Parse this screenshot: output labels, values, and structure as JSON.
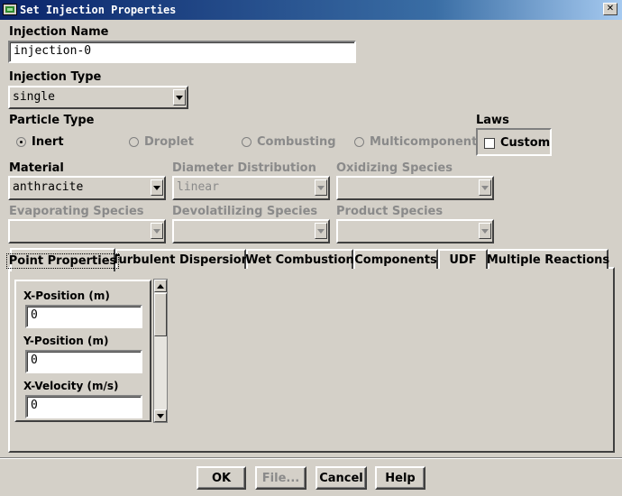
{
  "window": {
    "title": "Set Injection Properties",
    "close_glyph": "✕"
  },
  "injection_name": {
    "label": "Injection Name",
    "value": "injection-0"
  },
  "injection_type": {
    "label": "Injection Type",
    "value": "single"
  },
  "particle_type": {
    "label": "Particle Type",
    "options": [
      {
        "label": "Inert",
        "selected": true,
        "enabled": true
      },
      {
        "label": "Droplet",
        "selected": false,
        "enabled": false
      },
      {
        "label": "Combusting",
        "selected": false,
        "enabled": false
      },
      {
        "label": "Multicomponent",
        "selected": false,
        "enabled": false
      }
    ]
  },
  "laws": {
    "label": "Laws",
    "custom_label": "Custom",
    "custom_checked": false
  },
  "material": {
    "label": "Material",
    "value": "anthracite"
  },
  "diameter_distribution": {
    "label": "Diameter Distribution",
    "value": "linear"
  },
  "oxidizing_species": {
    "label": "Oxidizing Species",
    "value": ""
  },
  "evaporating_species": {
    "label": "Evaporating Species",
    "value": ""
  },
  "devolatilizing_species": {
    "label": "Devolatilizing Species",
    "value": ""
  },
  "product_species": {
    "label": "Product Species",
    "value": ""
  },
  "tabs": [
    {
      "label": "Point Properties",
      "active": true
    },
    {
      "label": "Turbulent Dispersion",
      "active": false
    },
    {
      "label": "Wet Combustion",
      "active": false
    },
    {
      "label": "Components",
      "active": false
    },
    {
      "label": "UDF",
      "active": false
    },
    {
      "label": "Multiple Reactions",
      "active": false
    }
  ],
  "point_properties": [
    {
      "label": "X-Position (m)",
      "value": "0"
    },
    {
      "label": "Y-Position (m)",
      "value": "0"
    },
    {
      "label": "X-Velocity (m/s)",
      "value": "0"
    }
  ],
  "buttons": {
    "ok": "OK",
    "file": "File...",
    "cancel": "Cancel",
    "help": "Help"
  },
  "colors": {
    "titlebar_start": "#0a246a",
    "titlebar_end": "#a6caf0",
    "face": "#d4d0c8",
    "disabled_text": "#8a8a8a"
  }
}
